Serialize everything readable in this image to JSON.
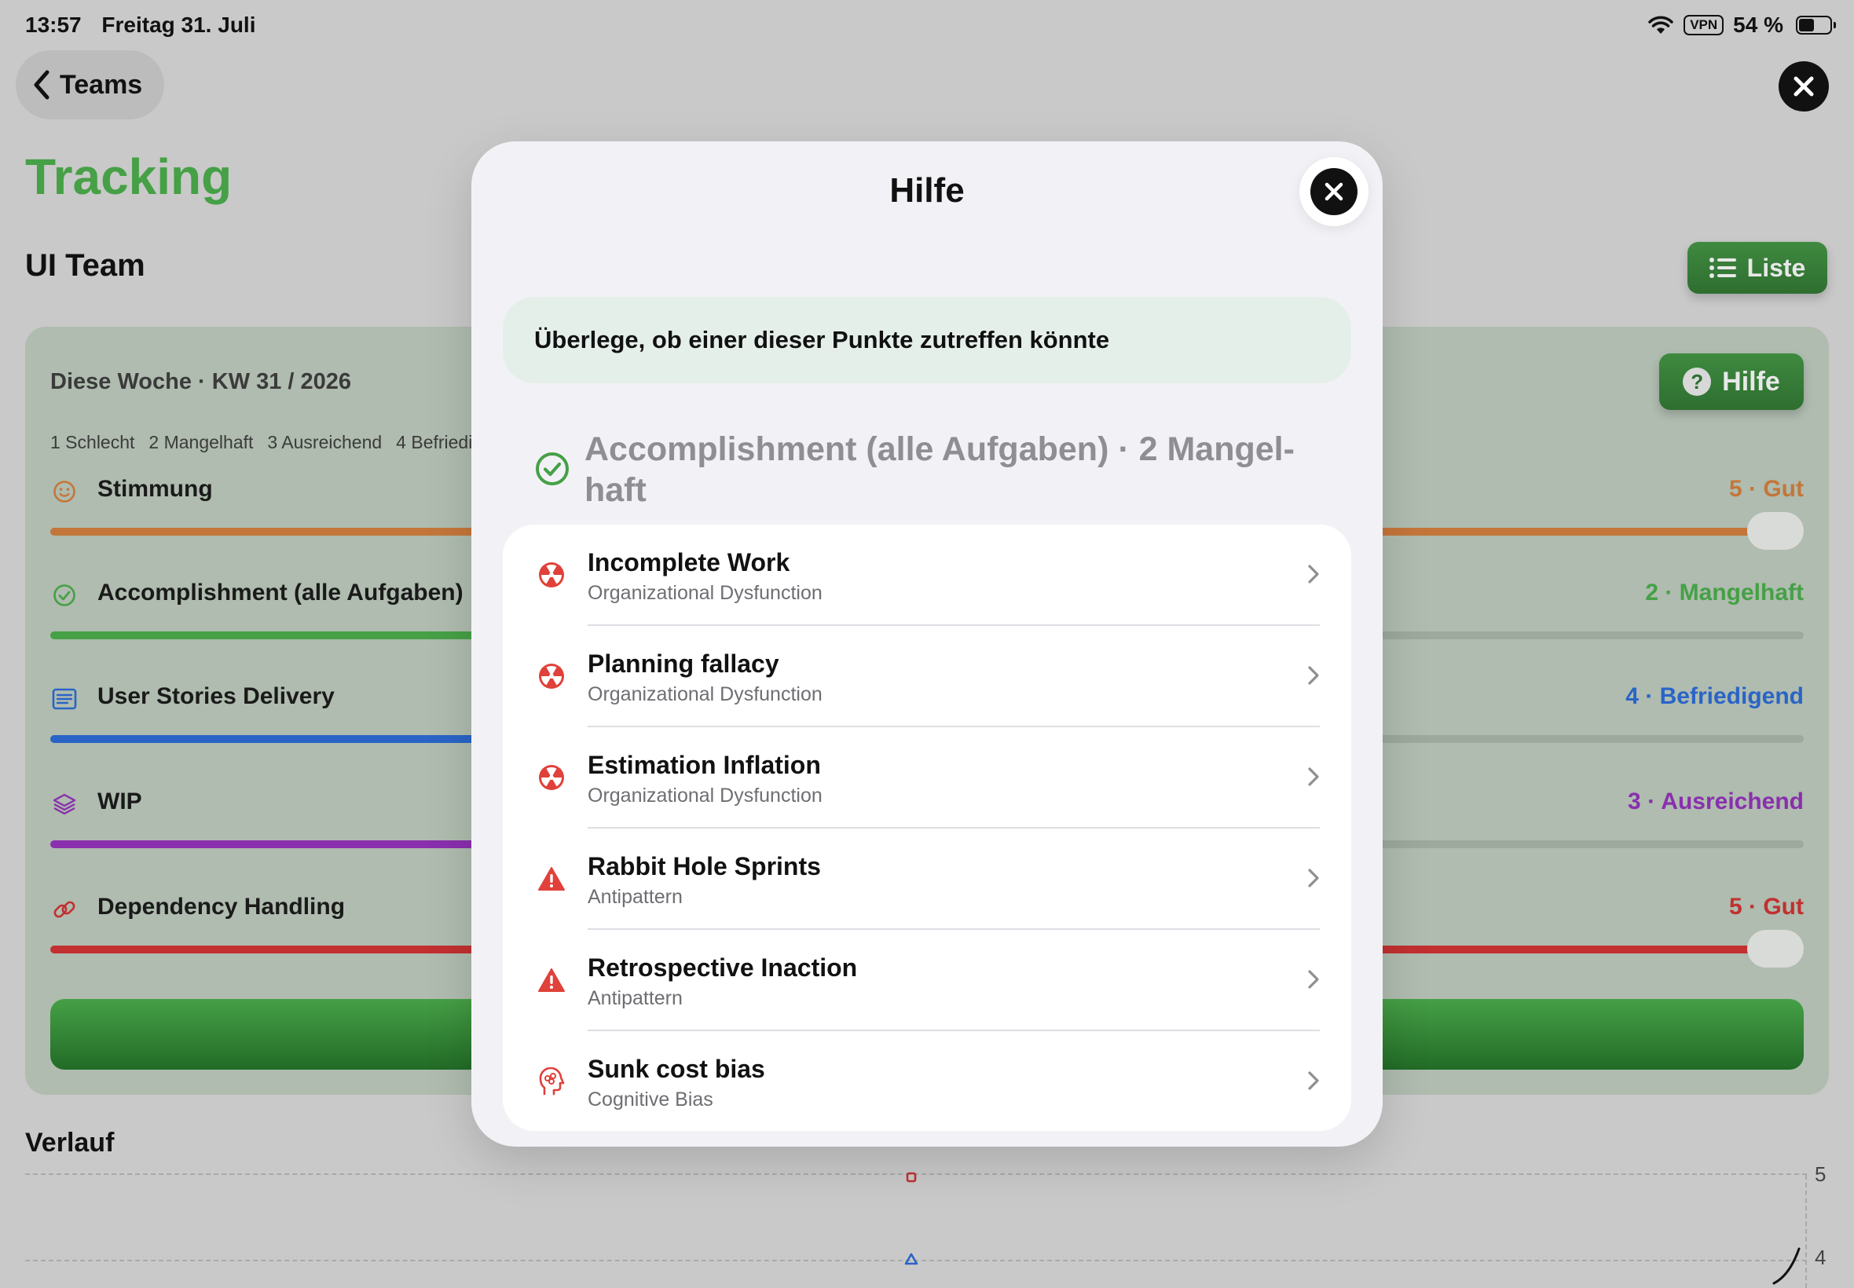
{
  "status_bar": {
    "time": "13:57",
    "date": "Freitag 31. Juli",
    "vpn": "VPN",
    "battery": "54 %",
    "battery_level": 54
  },
  "nav": {
    "back_label": "Teams"
  },
  "page": {
    "title": "Tracking",
    "team": "UI Team",
    "list_button": "Liste"
  },
  "week_card": {
    "label": "Diese Woche · KW 31 / 2026",
    "help_button": "Hilfe",
    "legend": [
      "1 Schlecht",
      "2 Mangelhaft",
      "3 Ausreichend",
      "4 Befriedigend"
    ],
    "metrics": [
      {
        "name": "Stimmung",
        "value_label": "5 · Gut",
        "level": 5,
        "color": "#c4763a",
        "icon": "smiley-icon"
      },
      {
        "name": "Accomplishment (alle Aufgaben)",
        "value_label": "2 · Mangelhaft",
        "level": 2,
        "color": "#46a046",
        "icon": "check-circle-icon"
      },
      {
        "name": "User Stories Delivery",
        "value_label": "4 · Befriedigend",
        "level": 4,
        "color": "#2a64c7",
        "icon": "list-card-icon"
      },
      {
        "name": "WIP",
        "value_label": "3 · Ausreichend",
        "level": 3,
        "color": "#8a2fae",
        "icon": "layers-icon"
      },
      {
        "name": "Dependency Handling",
        "value_label": "5 · Gut",
        "level": 5,
        "color": "#c23030",
        "icon": "link-icon"
      }
    ]
  },
  "history": {
    "title": "Verlauf",
    "y_ticks": [
      "5",
      "4"
    ]
  },
  "modal": {
    "title": "Hilfe",
    "hint": "Überlege, ob einer dieser Punkte zutreffen könnte",
    "section_title": "Accomplishment (alle Aufgaben) · 2 Mangel-haft",
    "items": [
      {
        "title": "Incomplete Work",
        "subtitle": "Organizational Dysfunction",
        "icon": "radiation-icon"
      },
      {
        "title": "Planning fallacy",
        "subtitle": "Organizational Dysfunction",
        "icon": "radiation-icon"
      },
      {
        "title": "Estimation Inflation",
        "subtitle": "Organizational Dysfunction",
        "icon": "radiation-icon"
      },
      {
        "title": "Rabbit Hole Sprints",
        "subtitle": "Antipattern",
        "icon": "warning-triangle-icon"
      },
      {
        "title": "Retrospective Inaction",
        "subtitle": "Antipattern",
        "icon": "warning-triangle-icon"
      },
      {
        "title": "Sunk cost bias",
        "subtitle": "Cognitive Bias",
        "icon": "brain-head-icon"
      }
    ]
  },
  "colors": {
    "accent_green": "#46a046",
    "danger_red": "#e0413a"
  }
}
